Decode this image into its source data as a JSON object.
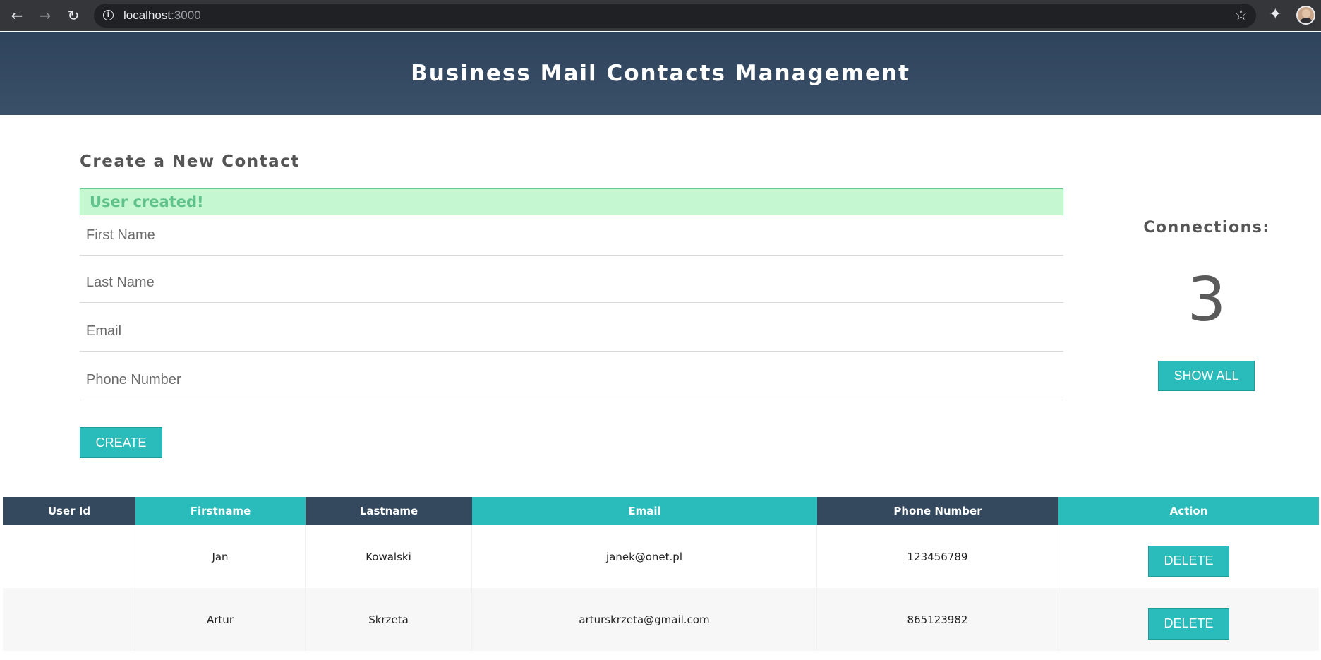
{
  "browser": {
    "url_host": "localhost",
    "url_port": ":3000"
  },
  "header": {
    "title": "Business Mail Contacts Management"
  },
  "form": {
    "heading": "Create a New Contact",
    "alert": "User created!",
    "fields": {
      "first_name": {
        "placeholder": "First Name",
        "value": ""
      },
      "last_name": {
        "placeholder": "Last Name",
        "value": ""
      },
      "email": {
        "placeholder": "Email",
        "value": ""
      },
      "phone": {
        "placeholder": "Phone Number",
        "value": ""
      }
    },
    "create_label": "CREATE"
  },
  "connections": {
    "label": "Connections:",
    "count": "3",
    "show_all_label": "SHOW ALL"
  },
  "table": {
    "headers": [
      "User Id",
      "Firstname",
      "Lastname",
      "Email",
      "Phone Number",
      "Action"
    ],
    "rows": [
      {
        "user_id": "",
        "firstname": "Jan",
        "lastname": "Kowalski",
        "email": "janek@onet.pl",
        "phone": "123456789",
        "action": "DELETE"
      },
      {
        "user_id": "",
        "firstname": "Artur",
        "lastname": "Skrzeta",
        "email": "arturskrzeta@gmail.com",
        "phone": "865123982",
        "action": "DELETE"
      }
    ]
  },
  "colors": {
    "header_bg": "#34495e",
    "accent_teal": "#2abbbb",
    "alert_bg": "#c5f7d0",
    "alert_text": "#5fc389"
  }
}
